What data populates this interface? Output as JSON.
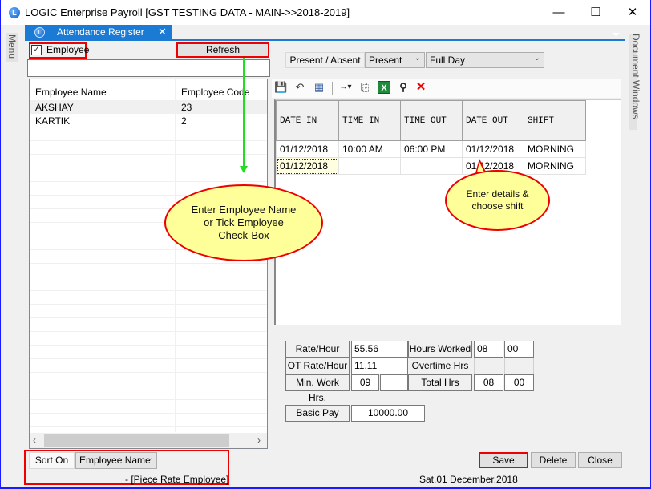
{
  "window": {
    "title": "LOGIC Enterprise Payroll  [GST TESTING DATA - MAIN->>2018-2019]",
    "logo_letter": "L",
    "minimize_glyph": "—",
    "maximize_glyph": "☐",
    "close_glyph": "✕"
  },
  "side_panels": {
    "left": "Menu",
    "right": "Document Windows"
  },
  "tab": {
    "label": "Attendance Register",
    "close_glyph": "✕",
    "logo_letter": "L"
  },
  "left_panel": {
    "employee_checkbox": {
      "label": "Employee",
      "checked": true,
      "check_glyph": "✓"
    },
    "refresh_button": "Refresh",
    "employee_search": {
      "value": "",
      "placeholder": ""
    },
    "employee_list": {
      "columns": [
        "Employee Name",
        "Employee Code"
      ],
      "rows": [
        {
          "name": "AKSHAY",
          "code": "23",
          "selected": true
        },
        {
          "name": "KARTIK",
          "code": "2",
          "selected": false
        }
      ]
    },
    "scroll_left_glyph": "‹",
    "scroll_right_glyph": "›"
  },
  "attendance_filters": {
    "present_absent_label": "Present / Absent",
    "status_select": "Present",
    "day_select": "Full Day",
    "chevron_glyph": "⌄"
  },
  "toolbar": {
    "icons": [
      {
        "name": "save-icon",
        "glyph": "💾"
      },
      {
        "name": "undo-icon",
        "glyph": "↶"
      },
      {
        "name": "window-icon",
        "glyph": "▦"
      },
      {
        "name": "column-width-icon",
        "glyph": "↔▾"
      },
      {
        "name": "copy-icon",
        "glyph": "⎘"
      },
      {
        "name": "excel-icon",
        "glyph": "X"
      },
      {
        "name": "find-icon",
        "glyph": "⚲"
      },
      {
        "name": "delete-icon",
        "glyph": "✕"
      }
    ]
  },
  "attendance_grid": {
    "columns": [
      "DATE IN",
      "TIME IN",
      "TIME OUT",
      "DATE OUT",
      "SHIFT"
    ],
    "rows": [
      [
        "01/12/2018",
        "10:00 AM",
        "06:00 PM",
        "01/12/2018",
        "MORNING"
      ],
      [
        "01/12/2018",
        "",
        "",
        "01/12/2018",
        "MORNING"
      ]
    ]
  },
  "pay_details": {
    "rate_hour_label": "Rate/Hour",
    "rate_hour": "55.56",
    "ot_rate_label": "OT Rate/Hour",
    "ot_rate": "11.11",
    "min_work_label": "Min. Work Hrs.",
    "min_work_hh": "09",
    "min_work_mm": "",
    "hours_worked_label": "Hours Worked",
    "hours_worked_hh": "08",
    "hours_worked_mm": "00",
    "overtime_label": "Overtime Hrs",
    "overtime_hh": "",
    "overtime_mm": "",
    "total_label": "Total Hrs",
    "total_hh": "08",
    "total_mm": "00",
    "basic_pay_label": "Basic Pay",
    "basic_pay": "10000.00"
  },
  "footer": {
    "sort_label": "Sort On",
    "sort_select": "Employee Name",
    "employee_type": "- [Piece Rate Employee]",
    "date": "Sat,01 December,2018",
    "save": "Save",
    "delete": "Delete",
    "close": "Close"
  },
  "annotations": {
    "callout_1": "Enter Employee Name or Tick Employee Check-Box",
    "callout_2": "Enter details & choose shift",
    "highlight_color": "#e00000",
    "arrow_color": "#22dd22",
    "callout_fill": "#ffff99"
  }
}
